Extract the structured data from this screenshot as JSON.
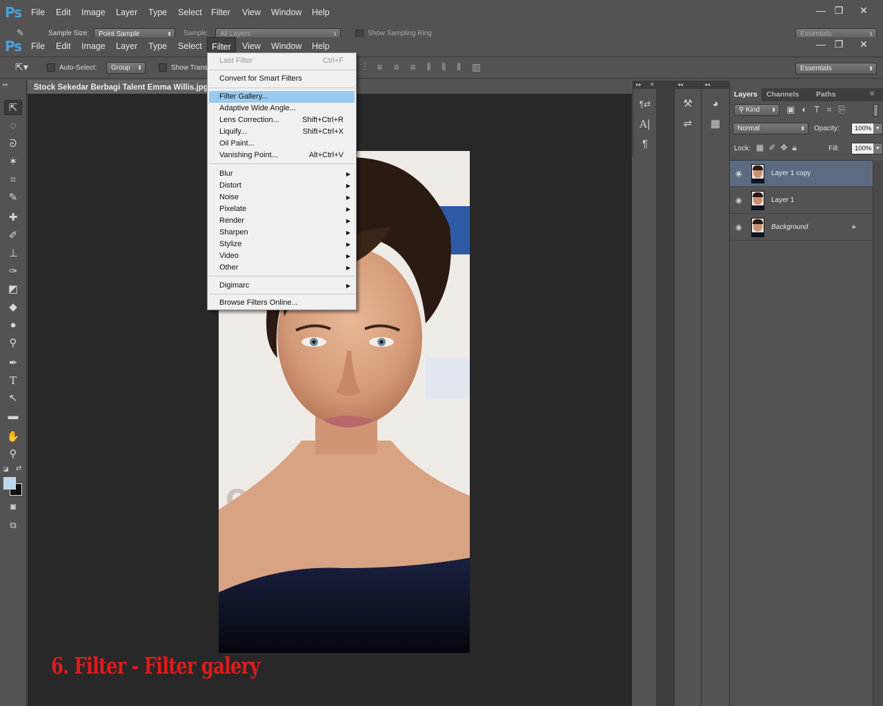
{
  "app": {
    "logo": "Ps"
  },
  "menubar": {
    "items": [
      "File",
      "Edit",
      "Image",
      "Layer",
      "Type",
      "Select",
      "Filter",
      "View",
      "Window",
      "Help"
    ],
    "active": "Filter"
  },
  "window_controls": {
    "minimize": "—",
    "restore": "❐",
    "close": "✕"
  },
  "ghost_options": {
    "sample_size_label": "Sample Size:",
    "sample_size_value": "Point Sample",
    "sample_label": "Sample:",
    "sample_value": "All Layers",
    "sampling_ring_label": "Show Sampling Ring",
    "workspace": "Essentials"
  },
  "options": {
    "auto_select_label": "Auto-Select:",
    "auto_select_value": "Group",
    "show_transform_label": "Show Trans",
    "workspace": "Essentials"
  },
  "document": {
    "tab_title": "Stock Sekedar Berbagi Talent Emma Willis.jpg"
  },
  "filter_menu": {
    "last_filter": "Last Filter",
    "last_filter_shortcut": "Ctrl+F",
    "convert_smart": "Convert for Smart Filters",
    "filter_gallery": "Filter Gallery...",
    "adaptive_wide_angle": "Adaptive Wide Angle...",
    "lens_correction": "Lens Correction...",
    "lens_correction_shortcut": "Shift+Ctrl+R",
    "liquify": "Liquify...",
    "liquify_shortcut": "Shift+Ctrl+X",
    "oil_paint": "Oil Paint...",
    "vanishing_point": "Vanishing Point...",
    "vanishing_point_shortcut": "Alt+Ctrl+V",
    "submenus": [
      "Blur",
      "Distort",
      "Noise",
      "Pixelate",
      "Render",
      "Sharpen",
      "Stylize",
      "Video",
      "Other"
    ],
    "digimarc": "Digimarc",
    "browse_online": "Browse Filters Online..."
  },
  "layers_panel": {
    "tabs": [
      "Layers",
      "Channels",
      "Paths"
    ],
    "kind_filter": "Kind",
    "blend_mode": "Normal",
    "opacity_label": "Opacity:",
    "opacity_value": "100%",
    "lock_label": "Lock:",
    "fill_label": "Fill:",
    "fill_value": "100%",
    "layers": [
      {
        "name": "Layer 1 copy",
        "selected": true
      },
      {
        "name": "Layer 1",
        "selected": false
      },
      {
        "name": "Background",
        "selected": false,
        "locked": true
      }
    ]
  },
  "annotation": {
    "caption": "6. Filter - Filter galery"
  },
  "colors": {
    "ui_bg": "#535353",
    "canvas_bg": "#282828",
    "menu_highlight": "#99c9ef",
    "selected_layer": "#5c6b82",
    "caption_red": "#e21a1a",
    "foreground_swatch": "#b7d7f2",
    "background_swatch": "#111111"
  }
}
